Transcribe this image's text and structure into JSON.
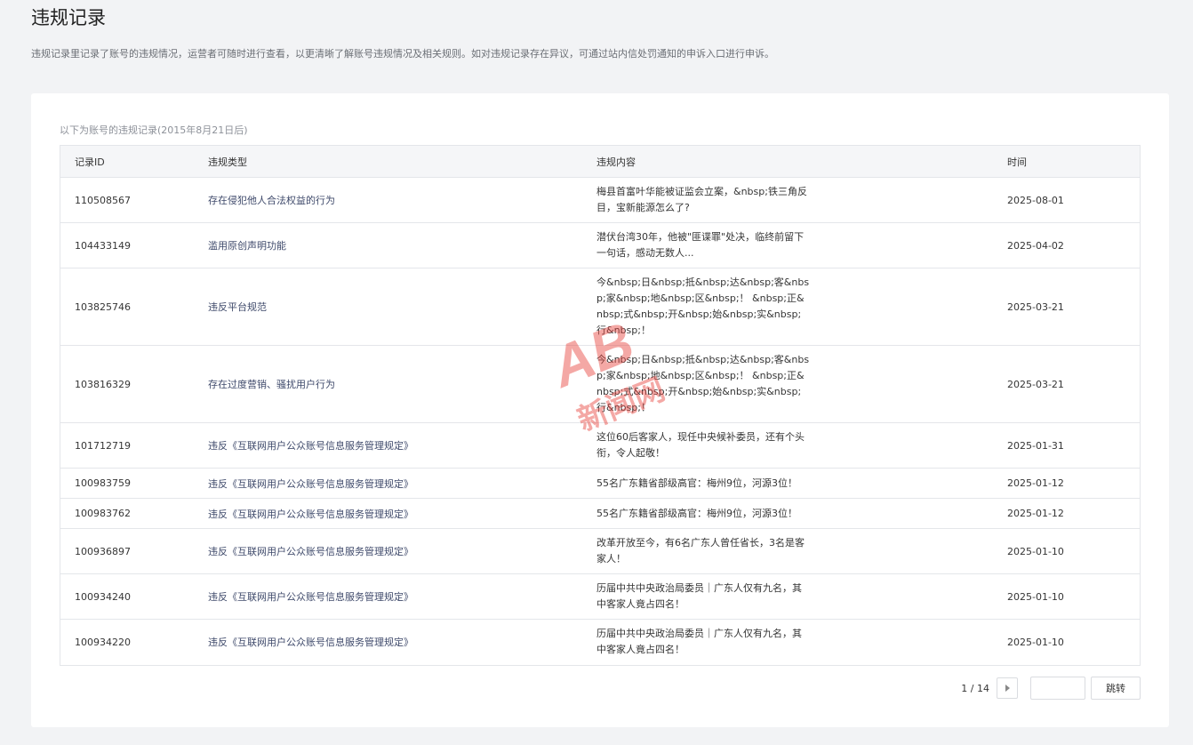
{
  "page": {
    "title": "违规记录",
    "description": "违规记录里记录了账号的违规情况，运营者可随时进行查看，以更清晰了解账号违规情况及相关规则。如对违规记录存在异议，可通过站内信处罚通知的申诉入口进行申诉。"
  },
  "table": {
    "caption": "以下为账号的违规记录(2015年8月21日后)",
    "headers": {
      "id": "记录ID",
      "type": "违规类型",
      "content": "违规内容",
      "time": "时间"
    },
    "rows": [
      {
        "id": "110508567",
        "type": "存在侵犯他人合法权益的行为",
        "content": "梅县首富叶华能被证监会立案，&nbsp;铁三角反目，宝新能源怎么了?",
        "time": "2025-08-01"
      },
      {
        "id": "104433149",
        "type": "滥用原创声明功能",
        "content": "潜伏台湾30年，他被\"匪谍罪\"处决，临终前留下一句话，感动无数人...",
        "time": "2025-04-02"
      },
      {
        "id": "103825746",
        "type": "违反平台规范",
        "content": "今&nbsp;日&nbsp;抵&nbsp;达&nbsp;客&nbsp;家&nbsp;地&nbsp;区&nbsp;！ &nbsp;正&nbsp;式&nbsp;开&nbsp;始&nbsp;实&nbsp;行&nbsp;！",
        "time": "2025-03-21"
      },
      {
        "id": "103816329",
        "type": "存在过度营销、骚扰用户行为",
        "content": "今&nbsp;日&nbsp;抵&nbsp;达&nbsp;客&nbsp;家&nbsp;地&nbsp;区&nbsp;！ &nbsp;正&nbsp;式&nbsp;开&nbsp;始&nbsp;实&nbsp;行&nbsp;！",
        "time": "2025-03-21"
      },
      {
        "id": "101712719",
        "type": "违反《互联网用户公众账号信息服务管理规定》",
        "content": "这位60后客家人，现任中央候补委员，还有个头衔，令人起敬！",
        "time": "2025-01-31"
      },
      {
        "id": "100983759",
        "type": "违反《互联网用户公众账号信息服务管理规定》",
        "content": "55名广东籍省部级高官：梅州9位，河源3位！",
        "time": "2025-01-12"
      },
      {
        "id": "100983762",
        "type": "违反《互联网用户公众账号信息服务管理规定》",
        "content": "55名广东籍省部级高官：梅州9位，河源3位！",
        "time": "2025-01-12"
      },
      {
        "id": "100936897",
        "type": "违反《互联网用户公众账号信息服务管理规定》",
        "content": "改革开放至今，有6名广东人曾任省长，3名是客家人！",
        "time": "2025-01-10"
      },
      {
        "id": "100934240",
        "type": "违反《互联网用户公众账号信息服务管理规定》",
        "content": "历届中共中央政治局委员｜广东人仅有九名，其中客家人竟占四名！",
        "time": "2025-01-10"
      },
      {
        "id": "100934220",
        "type": "违反《互联网用户公众账号信息服务管理规定》",
        "content": "历届中共中央政治局委员｜广东人仅有九名，其中客家人竟占四名！",
        "time": "2025-01-10"
      }
    ]
  },
  "pagination": {
    "info": "1 / 14",
    "jump_value": "",
    "jump_label": "跳转",
    "next_icon": "caret-right-icon"
  },
  "watermark": {
    "logo_text": "AB",
    "caption": "新闻网",
    "color": "#e8403a"
  }
}
